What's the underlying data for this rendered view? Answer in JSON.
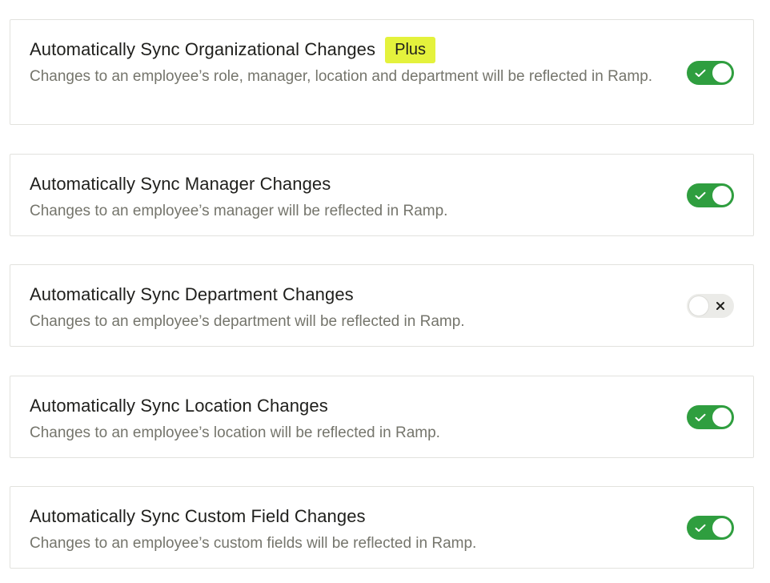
{
  "settings": [
    {
      "title": "Automatically Sync Organizational Changes",
      "badge": "Plus",
      "description": "Changes to an employee’s role, manager, location and department will be reflected in Ramp.",
      "enabled": true
    },
    {
      "title": "Automatically Sync Manager Changes",
      "description": "Changes to an employee’s manager will be reflected in Ramp.",
      "enabled": true
    },
    {
      "title": "Automatically Sync Department Changes",
      "description": "Changes to an employee’s department will be reflected in Ramp.",
      "enabled": false
    },
    {
      "title": "Automatically Sync Location Changes",
      "description": "Changes to an employee’s location will be reflected in Ramp.",
      "enabled": true
    },
    {
      "title": "Automatically Sync Custom Field Changes",
      "description": "Changes to an employee’s custom fields will be reflected in Ramp.",
      "enabled": true
    }
  ],
  "colors": {
    "toggle_on": "#2f9e3f",
    "toggle_off": "#ebebe8",
    "badge": "#e4f23c"
  },
  "icons": {
    "on": "check-icon",
    "off": "x-icon"
  }
}
